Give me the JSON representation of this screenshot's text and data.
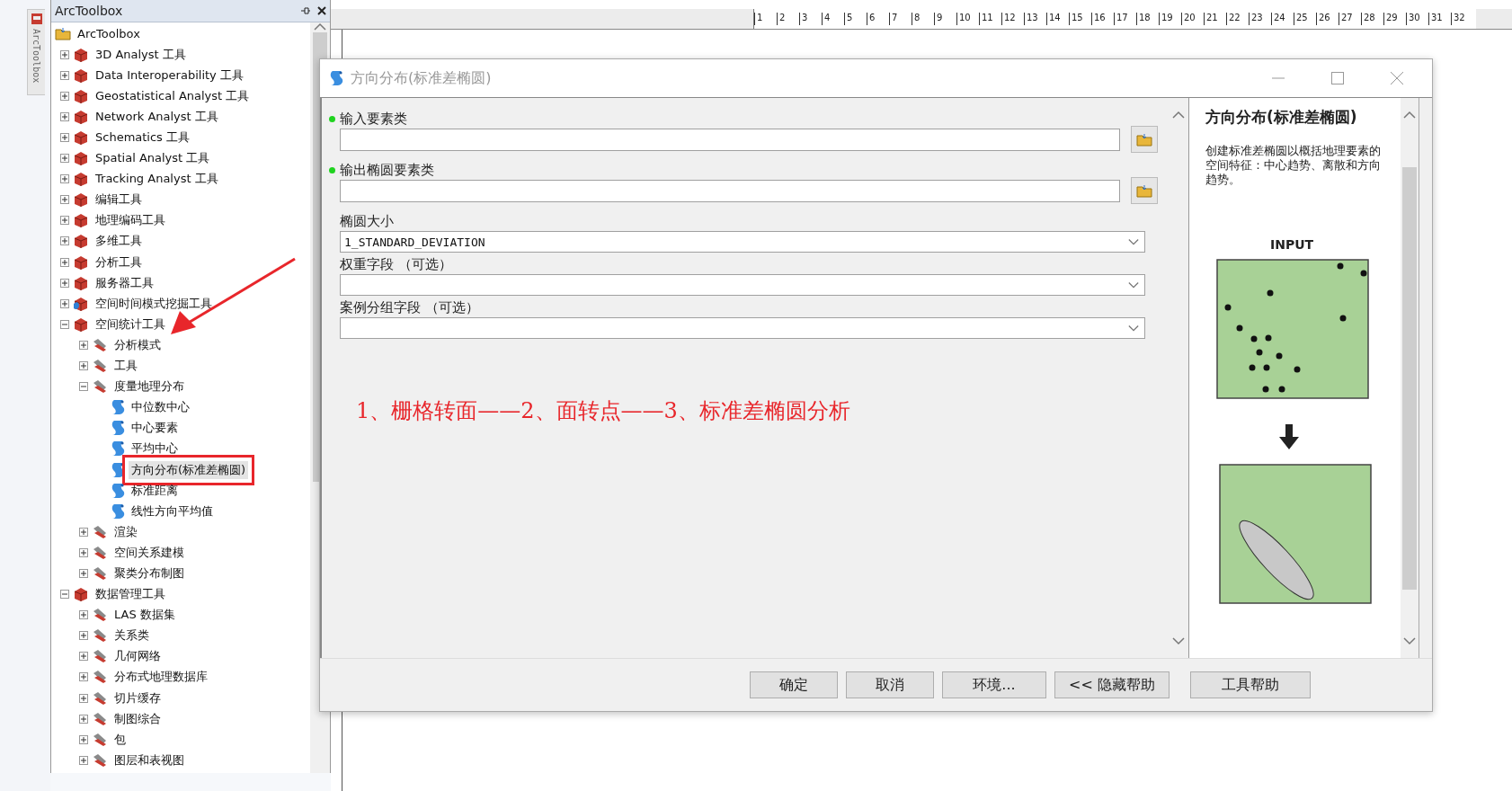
{
  "side_tab": {
    "label": "ArcToolbox"
  },
  "toolbox_panel": {
    "title": "ArcToolbox",
    "root": {
      "label": "ArcToolbox",
      "children": [
        {
          "label": "3D Analyst 工具",
          "kind": "toolbox",
          "expanded": false
        },
        {
          "label": "Data Interoperability 工具",
          "kind": "toolbox",
          "expanded": false
        },
        {
          "label": "Geostatistical Analyst 工具",
          "kind": "toolbox",
          "expanded": false
        },
        {
          "label": "Network Analyst 工具",
          "kind": "toolbox",
          "expanded": false
        },
        {
          "label": "Schematics 工具",
          "kind": "toolbox",
          "expanded": false
        },
        {
          "label": "Spatial Analyst 工具",
          "kind": "toolbox",
          "expanded": false
        },
        {
          "label": "Tracking Analyst 工具",
          "kind": "toolbox",
          "expanded": false
        },
        {
          "label": "编辑工具",
          "kind": "toolbox",
          "expanded": false
        },
        {
          "label": "地理编码工具",
          "kind": "toolbox",
          "expanded": false
        },
        {
          "label": "多维工具",
          "kind": "toolbox",
          "expanded": false
        },
        {
          "label": "分析工具",
          "kind": "toolbox",
          "expanded": false
        },
        {
          "label": "服务器工具",
          "kind": "toolbox",
          "expanded": false
        },
        {
          "label": "空间时间模式挖掘工具",
          "kind": "toolbox-blue",
          "expanded": false
        },
        {
          "label": "空间统计工具",
          "kind": "toolbox",
          "expanded": true,
          "children": [
            {
              "label": "分析模式",
              "kind": "toolset",
              "expanded": false
            },
            {
              "label": "工具",
              "kind": "toolset",
              "expanded": false
            },
            {
              "label": "度量地理分布",
              "kind": "toolset",
              "expanded": true,
              "children": [
                {
                  "label": "中位数中心",
                  "kind": "tool",
                  "selected": false,
                  "marked": false
                },
                {
                  "label": "中心要素",
                  "kind": "tool",
                  "selected": false,
                  "marked": false
                },
                {
                  "label": "平均中心",
                  "kind": "tool",
                  "selected": false,
                  "marked": false
                },
                {
                  "label": "方向分布(标准差椭圆)",
                  "kind": "tool",
                  "selected": true,
                  "marked": true
                },
                {
                  "label": "标准距离",
                  "kind": "tool",
                  "selected": false,
                  "marked": false
                },
                {
                  "label": "线性方向平均值",
                  "kind": "tool",
                  "selected": false,
                  "marked": false
                }
              ]
            },
            {
              "label": "渲染",
              "kind": "toolset",
              "expanded": false
            },
            {
              "label": "空间关系建模",
              "kind": "toolset",
              "expanded": false
            },
            {
              "label": "聚类分布制图",
              "kind": "toolset",
              "expanded": false
            }
          ]
        },
        {
          "label": "数据管理工具",
          "kind": "toolbox",
          "expanded": true,
          "children": [
            {
              "label": "LAS 数据集",
              "kind": "toolset",
              "expanded": false
            },
            {
              "label": "关系类",
              "kind": "toolset",
              "expanded": false
            },
            {
              "label": "几何网络",
              "kind": "toolset",
              "expanded": false
            },
            {
              "label": "分布式地理数据库",
              "kind": "toolset",
              "expanded": false
            },
            {
              "label": "切片缓存",
              "kind": "toolset",
              "expanded": false
            },
            {
              "label": "制图综合",
              "kind": "toolset",
              "expanded": false
            },
            {
              "label": "包",
              "kind": "toolset",
              "expanded": false
            },
            {
              "label": "图层和表视图",
              "kind": "toolset",
              "expanded": false
            }
          ]
        }
      ]
    }
  },
  "ruler_ticks": [
    "1",
    "2",
    "3",
    "4",
    "5",
    "6",
    "7",
    "8",
    "9",
    "10",
    "11",
    "12",
    "13",
    "14",
    "15",
    "16",
    "17",
    "18",
    "19",
    "20",
    "21",
    "22",
    "23",
    "24",
    "25",
    "26",
    "27",
    "28",
    "29",
    "30",
    "31",
    "32"
  ],
  "dialog": {
    "title": "方向分布(标准差椭圆)",
    "parameters": [
      {
        "label": "输入要素类",
        "kind": "file",
        "required": true
      },
      {
        "label": "输出椭圆要素类",
        "kind": "file",
        "required": true
      },
      {
        "label": "椭圆大小",
        "kind": "select",
        "required": false,
        "value": "1_STANDARD_DEVIATION"
      },
      {
        "label": "权重字段 （可选）",
        "kind": "select",
        "required": false
      },
      {
        "label": "案例分组字段 （可选）",
        "kind": "select",
        "required": false
      }
    ],
    "annotation": "1、栅格转面——2、面转点——3、标准差椭圆分析",
    "help": {
      "title": "方向分布(标准差椭圆)",
      "description": "创建标准差椭圆以概括地理要素的空间特征：中心趋势、离散和方向趋势。",
      "figure_label": "INPUT"
    },
    "buttons": [
      "确定",
      "取消",
      "环境...",
      "<< 隐藏帮助",
      "工具帮助"
    ]
  }
}
